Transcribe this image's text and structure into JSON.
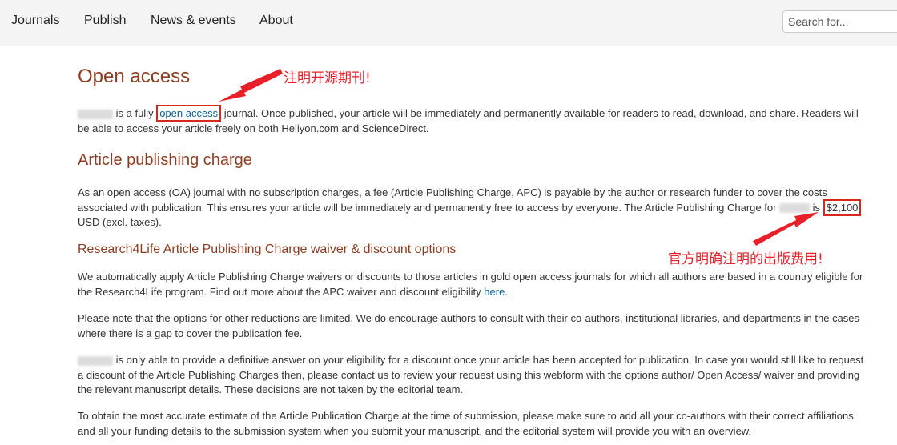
{
  "nav": {
    "items": [
      "Journals",
      "Publish",
      "News & events",
      "About"
    ],
    "search_placeholder": "Search for..."
  },
  "open_access": {
    "heading": "Open access",
    "para_mid": " is a fully ",
    "link": "open access",
    "para_rest": " journal. Once published, your article will be immediately and permanently available for readers to read, download, and share. Readers will be able to access your article freely on both Heliyon.com and ScienceDirect."
  },
  "apc": {
    "heading": "Article publishing charge",
    "para_a": "As an open access (OA) journal with no subscription charges, a fee (Article Publishing Charge, APC) is payable by the author or research funder to cover the costs associated with publication. This ensures your article will be immediately and permanently free to access by everyone. The Article Publishing Charge for ",
    "para_b": " is ",
    "price": "$2,100",
    "para_c": " USD (excl. taxes)."
  },
  "waiver": {
    "heading": "Research4Life Article Publishing Charge waiver & discount options",
    "para1_text": "We automatically apply Article Publishing Charge waivers or discounts to those articles in gold open access journals for which all authors are based in a country eligible for the Research4Life program. Find out more about the APC waiver and discount eligibility ",
    "para1_link": "here",
    "para1_end": ".",
    "para2": "Please note that the options for other reductions are limited. We do encourage authors to consult with their co-authors, institutional libraries, and departments in the cases where there is a gap to cover the publication fee.",
    "para3": " is only able to provide a definitive answer on your eligibility for a discount once your article has been accepted for publication. In case you would still like to request a discount of the Article Publishing Charges then, please contact us to review your request using this webform with the options author/ Open Access/ waiver and providing the relevant manuscript details. These decisions are not taken by the editorial team.",
    "para4": "To obtain the most accurate estimate of the Article Publication Charge at the time of submission, please make sure to add all your co-authors with their correct affiliations and all your funding details to the submission system when you submit your manuscript, and the editorial system will provide you with an overview."
  },
  "annotations": {
    "note1": "注明开源期刊!",
    "note2": "官方明确注明的出版费用!",
    "color": "#e8202a"
  }
}
